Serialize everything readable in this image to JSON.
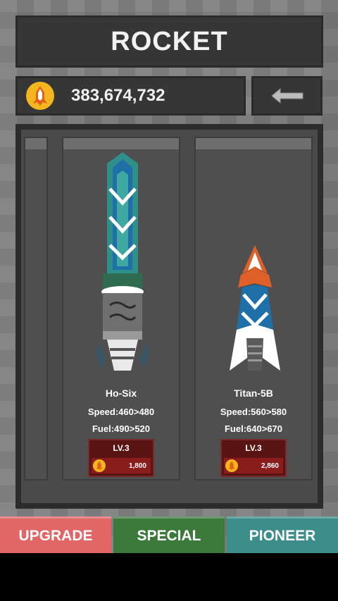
{
  "header": {
    "title": "ROCKET"
  },
  "currency": {
    "amount": "383,674,732",
    "icon": "rocket-coin-icon"
  },
  "back_button": {
    "icon": "back-arrow-icon"
  },
  "rockets": [
    {
      "name": "Ho-Six",
      "speed": "Speed:460>480",
      "fuel": "Fuel:490>520",
      "level": "LV.3",
      "cost": "1,800"
    },
    {
      "name": "Titan-5B",
      "speed": "Speed:560>580",
      "fuel": "Fuel:640>670",
      "level": "LV.3",
      "cost": "2,860"
    }
  ],
  "tabs": [
    {
      "label": "UPGRADE",
      "color": "#e36666"
    },
    {
      "label": "SPECIAL",
      "color": "#3c7a3c"
    },
    {
      "label": "PIONEER",
      "color": "#3d8d8a"
    }
  ],
  "colors": {
    "coin": "#f3b61f",
    "level_button": "#5a1414"
  }
}
